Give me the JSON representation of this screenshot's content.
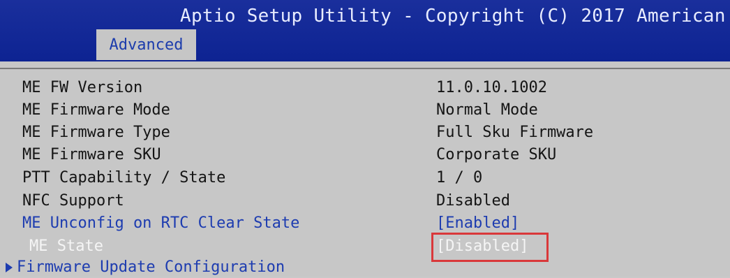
{
  "header": {
    "title": "Aptio Setup Utility - Copyright (C) 2017 American",
    "active_tab": "Advanced"
  },
  "settings": [
    {
      "label": "ME FW Version",
      "value": "11.0.10.1002"
    },
    {
      "label": "ME Firmware Mode",
      "value": "Normal Mode"
    },
    {
      "label": "ME Firmware Type",
      "value": "Full Sku Firmware"
    },
    {
      "label": "ME Firmware SKU",
      "value": "Corporate SKU"
    },
    {
      "label": "PTT Capability / State",
      "value": "1 / 0"
    },
    {
      "label": "NFC Support",
      "value": "Disabled"
    },
    {
      "label": "ME Unconfig on RTC Clear State",
      "value": "[Enabled]"
    },
    {
      "label": "ME State",
      "value": "[Disabled]"
    },
    {
      "label": "Firmware Update Configuration"
    }
  ],
  "colors": {
    "header_bg": "#0d2392",
    "panel_bg": "#c7c7c7",
    "option_text": "#1d3cb0",
    "highlight_box": "#d9383a"
  }
}
